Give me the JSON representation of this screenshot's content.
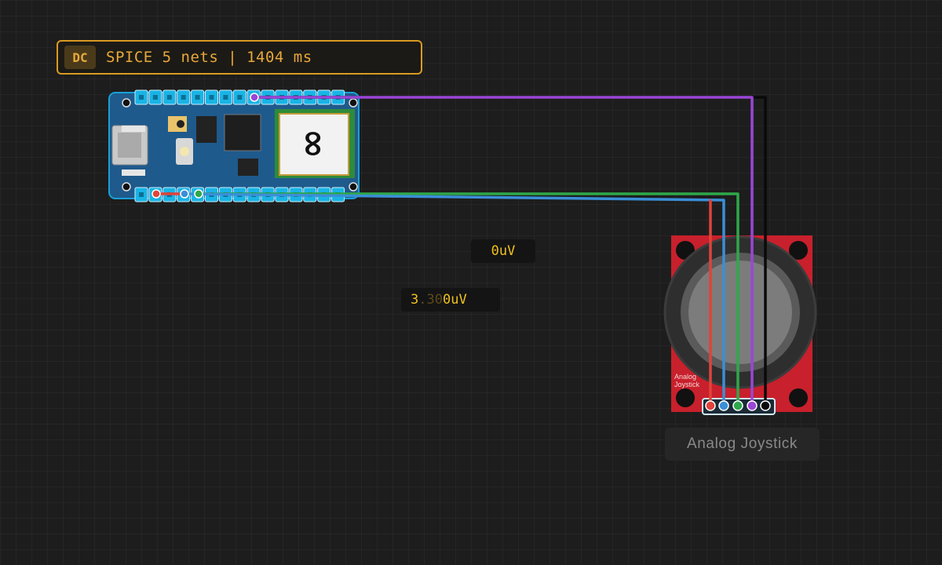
{
  "simulation": {
    "mode": "DC",
    "status": "SPICE 5 nets | 1404 ms"
  },
  "probes": [
    {
      "value": "0uV"
    },
    {
      "value_main": "3",
      "value_ghost": ".30",
      "value_tail": "0uV"
    }
  ],
  "components": {
    "board": {
      "name": "Arduino Nano (MCU board)",
      "logo": "∞"
    },
    "joystick": {
      "label": "Analog Joystick",
      "silkscreen_line1": "Analog",
      "silkscreen_line2": "Joystick"
    }
  },
  "wires": [
    {
      "name": "red",
      "color": "#e0433a"
    },
    {
      "name": "blue",
      "color": "#3a8fd8"
    },
    {
      "name": "green",
      "color": "#2ea84a"
    },
    {
      "name": "purple",
      "color": "#9a46d6"
    },
    {
      "name": "black",
      "color": "#0a0a0a"
    }
  ],
  "colors": {
    "accent": "#d99a22",
    "probe_text": "#f0c020",
    "board_blue": "#1f5a8c",
    "joystick_red": "#c8202c",
    "pin_highlight": "#19b4e6"
  }
}
